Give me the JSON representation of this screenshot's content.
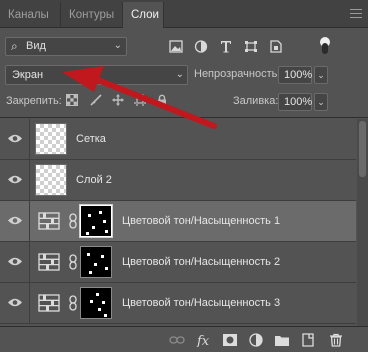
{
  "tabs": [
    {
      "label": "Каналы",
      "active": false
    },
    {
      "label": "Контуры",
      "active": false
    },
    {
      "label": "Слои",
      "active": true
    }
  ],
  "filter": {
    "kind_label": "Вид"
  },
  "blend": {
    "mode": "Экран"
  },
  "opacity": {
    "label": "Непрозрачность:",
    "value": "100%"
  },
  "lock": {
    "label": "Закрепить:"
  },
  "fill": {
    "label": "Заливка:",
    "value": "100%"
  },
  "layers": [
    {
      "name": "Сетка",
      "type": "pixel",
      "selected": false
    },
    {
      "name": "Слой 2",
      "type": "pixel",
      "selected": false
    },
    {
      "name": "Цветовой тон/Насыщенность 1",
      "type": "adjustment",
      "selected": true
    },
    {
      "name": "Цветовой тон/Насыщенность 2",
      "type": "adjustment",
      "selected": false
    },
    {
      "name": "Цветовой тон/Насыщенность 3",
      "type": "adjustment",
      "selected": false
    }
  ],
  "colors": {
    "panel": "#535353",
    "selected_row": "#6b6b6b",
    "annotation_arrow": "#c0181c"
  }
}
